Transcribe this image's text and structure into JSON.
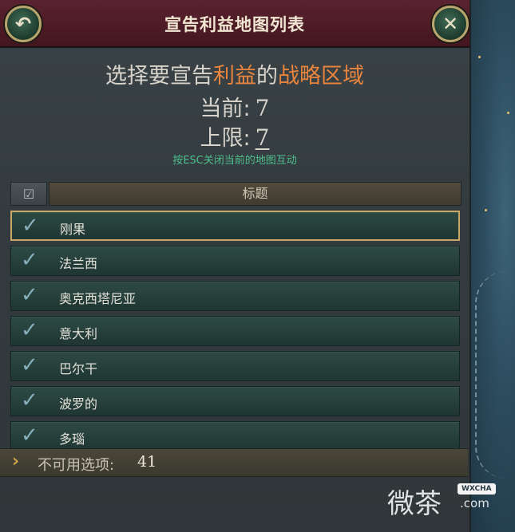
{
  "window": {
    "title": "宣告利益地图列表",
    "back_icon": "undo-arrow-icon",
    "close_icon": "close-x-icon"
  },
  "header": {
    "prompt_part1": "选择要宣告",
    "prompt_highlight1": "利益",
    "prompt_part2": "的",
    "prompt_highlight2": "战略区域",
    "current_label": "当前:",
    "current_value": "7",
    "limit_label": "上限:",
    "limit_value": "7",
    "hint": "按ESC关闭当前的地图互动"
  },
  "columns": {
    "check_icon": "checkbox-icon",
    "title": "标题"
  },
  "items": [
    {
      "label": "刚果",
      "checked": true,
      "selected": true
    },
    {
      "label": "法兰西",
      "checked": true,
      "selected": false
    },
    {
      "label": "奥克西塔尼亚",
      "checked": true,
      "selected": false
    },
    {
      "label": "意大利",
      "checked": true,
      "selected": false
    },
    {
      "label": "巴尔干",
      "checked": true,
      "selected": false
    },
    {
      "label": "波罗的",
      "checked": true,
      "selected": false
    },
    {
      "label": "多瑙",
      "checked": true,
      "selected": false
    }
  ],
  "footer": {
    "label": "不可用选项:",
    "count": "41"
  },
  "watermark": {
    "text": "微茶",
    "badge": "WXCHA",
    "suffix": ".com"
  },
  "colors": {
    "accent_orange": "#e8843d",
    "hint_green": "#4fbf8e",
    "title_bar": "#5a2230",
    "selected_border": "#c9a766"
  }
}
